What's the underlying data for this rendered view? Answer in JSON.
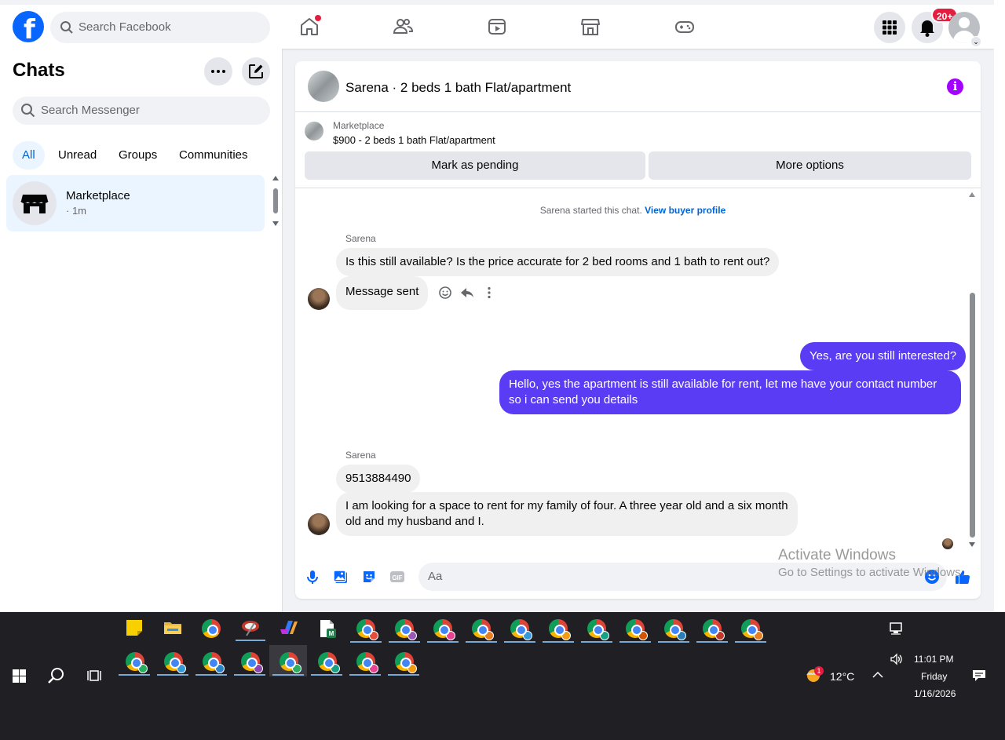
{
  "topnav": {
    "search_placeholder": "Search Facebook",
    "notification_count": "20+"
  },
  "sidebar": {
    "title": "Chats",
    "search_placeholder": "Search Messenger",
    "filters": [
      "All",
      "Unread",
      "Groups",
      "Communities"
    ],
    "active_filter": "All",
    "chats": [
      {
        "name": "Marketplace",
        "time": "· 1m"
      }
    ]
  },
  "conversation": {
    "title": "Sarena · 2 beds 1 bath Flat/apartment",
    "listing_label": "Marketplace",
    "listing_price_title": "$900 - 2 beds 1 bath Flat/apartment",
    "mark_pending_label": "Mark as pending",
    "more_options_label": "More options",
    "system_text": "Sarena started this chat.",
    "system_link": "View buyer profile",
    "messages": [
      {
        "from": "Sarena",
        "text": "Is this still available? Is the price accurate for 2 bed rooms and 1 bath to rent out?"
      },
      {
        "from": "Sarena",
        "text": "Message sent"
      },
      {
        "from": "me",
        "text": "Yes, are you still interested?"
      },
      {
        "from": "me",
        "text": "Hello, yes the apartment is still available for rent, let me have your contact number so i can send you details"
      },
      {
        "from": "Sarena",
        "text": "9513884490"
      },
      {
        "from": "Sarena",
        "text": "I am looking for a space to rent for my family of four. A three year old and a six month old and my husband and I."
      }
    ],
    "composer_placeholder": "Aa",
    "accent_color": "#5b3cf5",
    "info_color": "#a200ff"
  },
  "watermark": {
    "line1": "Activate Windows",
    "line2": "Go to Settings to activate Windows."
  },
  "taskbar": {
    "weather": "12°C",
    "time": "11:01 PM",
    "day": "Friday",
    "date": "1/16/2026",
    "weather_badge": "1"
  }
}
